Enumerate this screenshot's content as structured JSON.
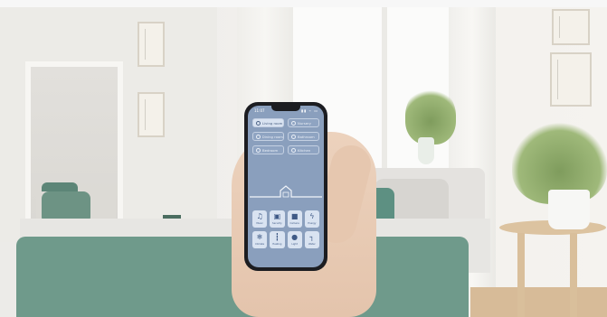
{
  "phone": {
    "time": "11:07",
    "status": "▮▮ ⌁ ▭",
    "rooms": [
      {
        "label": "Living room",
        "active": true
      },
      {
        "label": "Nursery",
        "active": false
      },
      {
        "label": "Dining room",
        "active": false
      },
      {
        "label": "Bathroom",
        "active": false
      },
      {
        "label": "Bedroom",
        "active": false
      },
      {
        "label": "Kitchen",
        "active": false
      }
    ],
    "controls": [
      {
        "icon": "music-icon",
        "glyph": "♫",
        "label": "Music"
      },
      {
        "icon": "lock-icon",
        "glyph": "▣",
        "label": "Security"
      },
      {
        "icon": "camera-icon",
        "glyph": "■",
        "label": "Camera"
      },
      {
        "icon": "bolt-icon",
        "glyph": "ϟ",
        "label": "Energy"
      },
      {
        "icon": "climate-icon",
        "glyph": "❄",
        "label": "Climate"
      },
      {
        "icon": "thermometer-icon",
        "glyph": "┇",
        "label": "Heating"
      },
      {
        "icon": "bulb-icon",
        "glyph": "●",
        "label": "Light"
      },
      {
        "icon": "tap-icon",
        "glyph": "┐",
        "label": "Water"
      }
    ]
  }
}
